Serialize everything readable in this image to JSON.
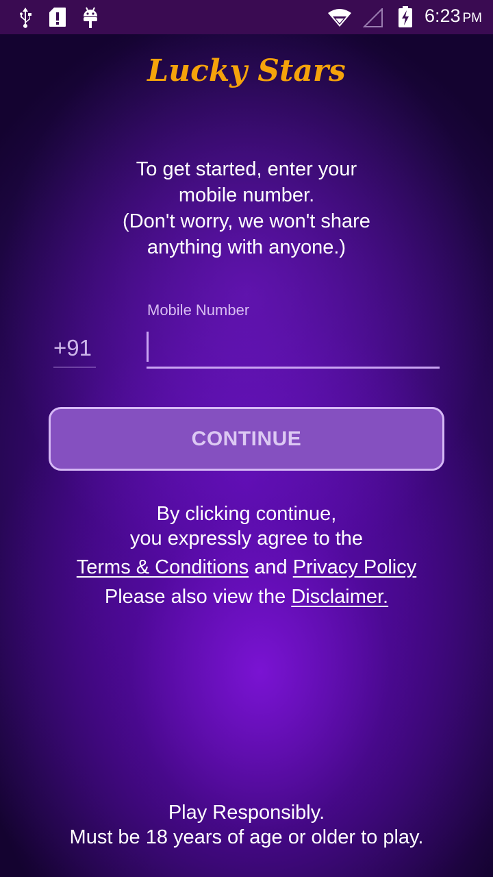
{
  "status_bar": {
    "time": "6:23",
    "ampm": "PM",
    "icons": [
      "usb-icon",
      "sd-card-alert-icon",
      "android-debug-icon",
      "wifi-icon",
      "signal-icon",
      "battery-charging-icon"
    ]
  },
  "header": {
    "app_name": "Lucky Stars",
    "brand_color": "#f5a30b"
  },
  "intro": {
    "line1": "To get started, enter your",
    "line2": "mobile number.",
    "line3": "(Don't worry, we won't share",
    "line4": "anything with anyone.)"
  },
  "phone_form": {
    "label": "Mobile Number",
    "country_code": "+91",
    "value": "",
    "continue_label": "CONTINUE"
  },
  "terms": {
    "line1": "By clicking continue,",
    "line2": "you expressly agree to the",
    "terms_link": "Terms & Conditions",
    "and": "and",
    "privacy_link": "Privacy Policy",
    "also_view": "Please also view the",
    "disclaimer_link": "Disclaimer."
  },
  "footer": {
    "line1": "Play Responsibly.",
    "line2": "Must be 18 years of age or older to play."
  },
  "colors": {
    "status_bar": "#3a0b52",
    "button_fill": "#8550c0",
    "button_border": "#d5b8f5",
    "input_underline": "#c9a4f2"
  }
}
